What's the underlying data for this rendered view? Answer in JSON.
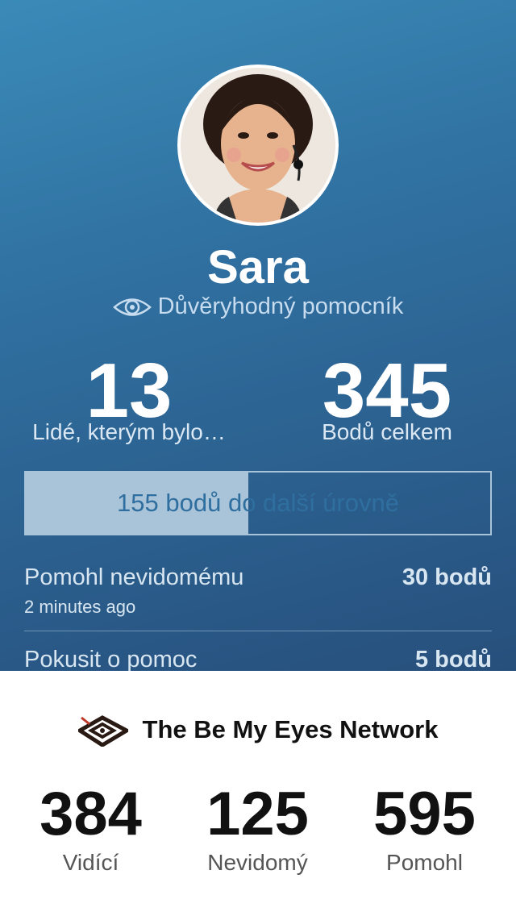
{
  "profile": {
    "name": "Sara",
    "role": "Důvěryhodný pomocník"
  },
  "stats": [
    {
      "value": "13",
      "label": "Lidé, kterým bylo…"
    },
    {
      "value": "345",
      "label": "Bodů celkem"
    }
  ],
  "progress": {
    "text": "155 bodů do další úrovně",
    "fraction": 0.48
  },
  "activities": [
    {
      "title": "Pomohl nevidomému",
      "points": "30 bodů",
      "time": "2 minutes ago"
    },
    {
      "title": "Pokusit o pomoc",
      "points": "5 bodů"
    }
  ],
  "network": {
    "title": "The Be My Eyes Network",
    "stats": [
      {
        "value": "384",
        "label": "Vidící"
      },
      {
        "value": "125",
        "label": "Nevidomý"
      },
      {
        "value": "595",
        "label": "Pomohl"
      }
    ]
  },
  "colors": {
    "gradient_top": "#3a8ab8",
    "gradient_bottom": "#274f7c",
    "progress_fill": "#a9c3d8"
  },
  "icons": [
    "eye-icon",
    "be-my-eyes-logo-icon"
  ]
}
